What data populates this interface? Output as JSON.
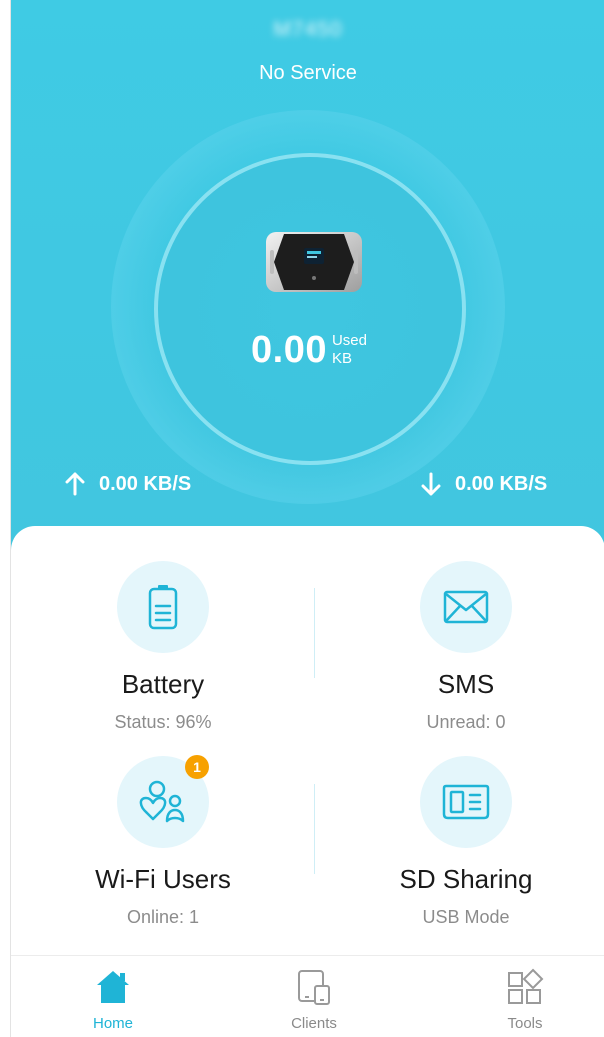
{
  "header": {
    "device_name": "M7450",
    "network_status": "No Service"
  },
  "usage": {
    "value": "0.00",
    "label": "Used",
    "unit": "KB"
  },
  "speed": {
    "upload": "0.00 KB/S",
    "download": "0.00 KB/S"
  },
  "tiles": {
    "battery": {
      "title": "Battery",
      "status": "Status: 96%",
      "icon": "battery-icon"
    },
    "sms": {
      "title": "SMS",
      "status": "Unread: 0",
      "icon": "envelope-icon"
    },
    "wifi_users": {
      "title": "Wi-Fi Users",
      "status": "Online: 1",
      "badge": "1",
      "icon": "users-icon"
    },
    "sd_sharing": {
      "title": "SD Sharing",
      "status": "USB Mode",
      "icon": "sd-card-icon"
    }
  },
  "tabs": [
    {
      "label": "Home",
      "icon": "home-icon",
      "active": true
    },
    {
      "label": "Clients",
      "icon": "devices-icon",
      "active": false
    },
    {
      "label": "Tools",
      "icon": "tools-grid-icon",
      "active": false
    }
  ],
  "colors": {
    "accent": "#1fb4d6",
    "hero": "#40c8e2",
    "badge": "#f7a100"
  }
}
